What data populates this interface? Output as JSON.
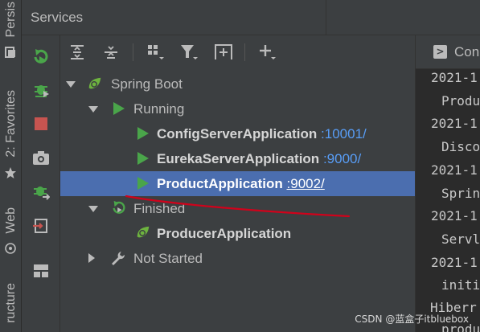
{
  "left_strip": {
    "tabs": [
      {
        "label": "Persis"
      },
      {
        "label": "2: Favorites"
      },
      {
        "label": "Web"
      },
      {
        "label": "ructure"
      }
    ]
  },
  "header": {
    "title": "Services"
  },
  "toolbar": {
    "buttons": [
      "expand-all",
      "collapse-all",
      "group-by",
      "filter",
      "new-service-group",
      "add-service"
    ]
  },
  "tree": {
    "spring_boot": "Spring Boot",
    "running": "Running",
    "config_server": "ConfigServerApplication",
    "config_port": ":10001/",
    "eureka_server": "EurekaServerApplication",
    "eureka_port": ":9000/",
    "product_app": "ProductApplication",
    "product_port": ":9002/",
    "finished": "Finished",
    "producer_app": "ProducerApplication",
    "not_started": "Not Started",
    "selected_item": "ProductApplication"
  },
  "console": {
    "tab_label": "Con",
    "lines": [
      "2021-1",
      "Produ",
      "2021-1",
      "Disco",
      "2021-1",
      "Sprin",
      "2021-1",
      "Servl",
      "2021-1",
      "initi",
      "Hiberr",
      "produ"
    ]
  },
  "watermark": "CSDN @蓝盒子itbluebox",
  "colors": {
    "panel_bg": "#3c3f41",
    "console_bg": "#2b2b2b",
    "selection": "#4b6eaf",
    "port_link": "#589df6",
    "run_green": "#4aa54a",
    "stop_red": "#c75450",
    "annotation_red": "#d0021b"
  }
}
